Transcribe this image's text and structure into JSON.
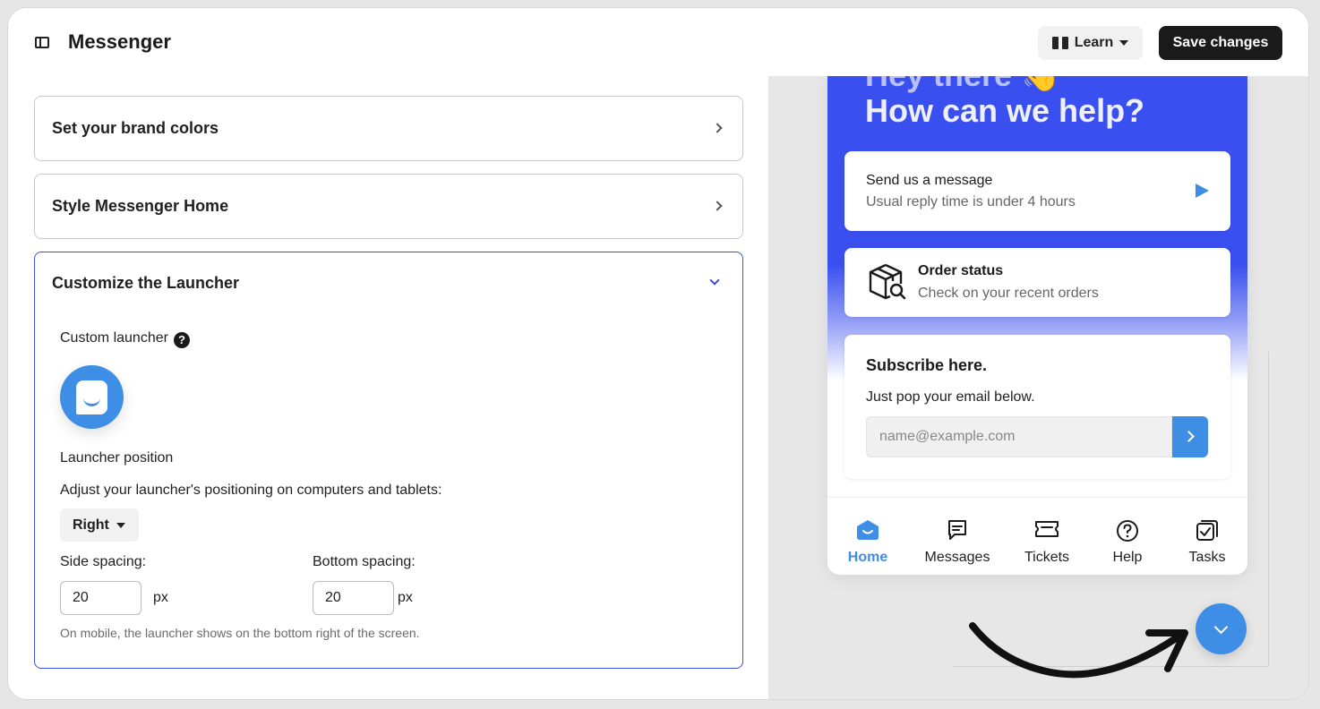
{
  "header": {
    "title": "Messenger",
    "learn_label": "Learn",
    "save_label": "Save changes"
  },
  "sections": {
    "brand_colors": "Set your brand colors",
    "style_home": "Style Messenger Home",
    "launcher": {
      "title": "Customize the Launcher",
      "custom_launcher_label": "Custom launcher",
      "position_heading": "Launcher position",
      "position_desc": "Adjust your launcher's positioning on computers and tablets:",
      "position_value": "Right",
      "side_spacing_label": "Side spacing:",
      "side_spacing_value": "20",
      "bottom_spacing_label": "Bottom spacing:",
      "bottom_spacing_value": "20",
      "unit": "px",
      "mobile_note": "On mobile, the launcher shows on the bottom right of the screen."
    }
  },
  "preview": {
    "greeting": "Hey there 👋",
    "headline": "How can we help?",
    "message_card": {
      "title": "Send us a message",
      "subtitle": "Usual reply time is under 4 hours"
    },
    "order_card": {
      "title": "Order status",
      "subtitle": "Check on your recent orders"
    },
    "subscribe_card": {
      "title": "Subscribe here.",
      "subtitle": "Just pop your email below.",
      "placeholder": "name@example.com"
    },
    "tabs": [
      {
        "label": "Home",
        "icon": "home-icon",
        "active": true
      },
      {
        "label": "Messages",
        "icon": "messages-icon",
        "active": false
      },
      {
        "label": "Tickets",
        "icon": "ticket-icon",
        "active": false
      },
      {
        "label": "Help",
        "icon": "help-circle-icon",
        "active": false
      },
      {
        "label": "Tasks",
        "icon": "tasks-icon",
        "active": false
      }
    ]
  },
  "colors": {
    "accent": "#3f8ee6",
    "hero": "#3a4ff0",
    "open_border": "#3b4fd8",
    "primary_button": "#1a1a1a"
  }
}
